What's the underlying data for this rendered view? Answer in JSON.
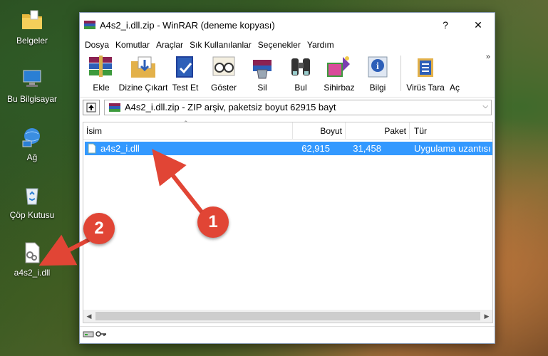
{
  "desktop": {
    "icons": [
      {
        "label": "Belgeler",
        "icon": "folder-icon"
      },
      {
        "label": "Bu Bilgisayar",
        "icon": "computer-icon"
      },
      {
        "label": "Ağ",
        "icon": "network-icon"
      },
      {
        "label": "Çöp Kutusu",
        "icon": "recycle-bin-icon"
      },
      {
        "label": "a4s2_i.dll",
        "icon": "dll-file-icon"
      }
    ]
  },
  "window": {
    "title": "A4s2_i.dll.zip - WinRAR (deneme kopyası)",
    "help_button": "?",
    "close_button": "✕"
  },
  "menu": [
    "Dosya",
    "Komutlar",
    "Araçlar",
    "Sık Kullanılanlar",
    "Seçenekler",
    "Yardım"
  ],
  "toolbar": {
    "buttons": [
      {
        "label": "Ekle",
        "icon": "add-books-icon"
      },
      {
        "label": "Dizine Çıkart",
        "icon": "extract-folder-icon"
      },
      {
        "label": "Test Et",
        "icon": "test-book-icon"
      },
      {
        "label": "Göster",
        "icon": "view-glasses-icon"
      },
      {
        "label": "Sil",
        "icon": "delete-icon"
      },
      {
        "label": "Bul",
        "icon": "binoculars-icon"
      },
      {
        "label": "Sihirbaz",
        "icon": "wizard-icon"
      },
      {
        "label": "Bilgi",
        "icon": "info-icon"
      },
      {
        "label": "Virüs Tara",
        "icon": "virus-scan-icon"
      },
      {
        "label": "Aç",
        "icon": "comment-icon"
      }
    ],
    "more": "»"
  },
  "address": {
    "text": "A4s2_i.dll.zip - ZIP arşiv, paketsiz boyut 62915 bayt"
  },
  "list": {
    "columns": [
      "İsim",
      "Boyut",
      "Paket",
      "Tür"
    ],
    "rows": [
      {
        "name": "a4s2_i.dll",
        "size": "62,915",
        "packed": "31,458",
        "type": "Uygulama uzantısı"
      }
    ]
  },
  "annotations": {
    "badge1": "1",
    "badge2": "2",
    "color": "#e14535"
  }
}
